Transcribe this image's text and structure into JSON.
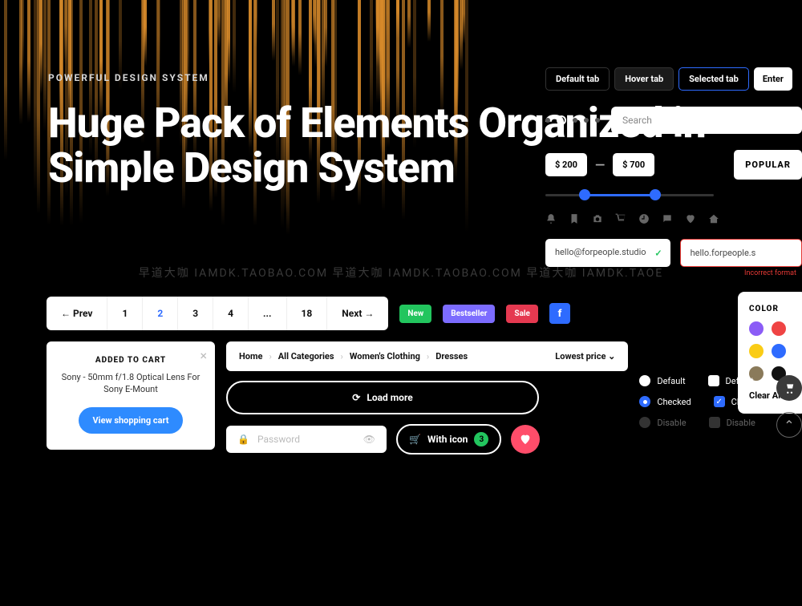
{
  "hero": {
    "eyebrow": "POWERFUL DESIGN SYSTEM",
    "headline": "Huge Pack of Elements Organized in Simple Design System"
  },
  "tabs": {
    "default": "Default tab",
    "hover": "Hover  tab",
    "selected": "Selected tab",
    "enter": "Enter"
  },
  "search": {
    "placeholder": "Search"
  },
  "price": {
    "min": "$ 200",
    "max": "$ 700",
    "popular": "POPULAR"
  },
  "emails": {
    "ok": "hello@forpeople.studio",
    "bad": "hello.forpeople.s",
    "err": "Incorrect format"
  },
  "watermark": "早道大咖  IAMDK.TAOBAO.COM      早道大咖  IAMDK.TAOBAO.COM      早道大咖  IAMDK.TAOE",
  "pagination": {
    "prev": "←  Prev",
    "pages": [
      "1",
      "2",
      "3",
      "4",
      "...",
      "18"
    ],
    "next": "Next  →",
    "active_index": 1
  },
  "badges": {
    "new": "New",
    "best": "Bestseller",
    "sale": "Sale"
  },
  "color_popover": {
    "title": "COLOR",
    "swatches": [
      "#8b5cf6",
      "#ef4444",
      "#facc15",
      "#2e6bff",
      "#8a7a5a",
      "#111111"
    ],
    "clear": "Clear All"
  },
  "cart": {
    "title": "ADDED TO CART",
    "desc": "Sony - 50mm f/1.8 Optical Lens For Sony E-Mount",
    "button": "View shopping cart"
  },
  "breadcrumb": {
    "items": [
      "Home",
      "All Categories",
      "Women's Clothing",
      "Dresses"
    ],
    "sort": "Lowest price"
  },
  "loadmore": "Load more",
  "password": {
    "placeholder": "Password"
  },
  "with_icon": {
    "label": "With icon",
    "count": "3"
  },
  "controls": {
    "default": "Default",
    "checked": "Checked",
    "disable": "Disable"
  }
}
